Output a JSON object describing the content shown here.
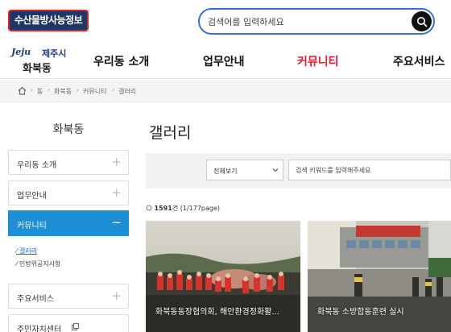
{
  "header": {
    "badge": "수산물방사능정보",
    "search_placeholder": "검색어를 입력하세요"
  },
  "logo": {
    "jeju": "Jeju",
    "city": "제주시",
    "dong": "화북동"
  },
  "nav": {
    "items": [
      {
        "label": "우리동 소개"
      },
      {
        "label": "업무안내"
      },
      {
        "label": "커뮤니티"
      },
      {
        "label": "주요서비스"
      }
    ],
    "active_index": 2
  },
  "breadcrumb": [
    "동",
    "화북동",
    "커뮤니티",
    "갤러리"
  ],
  "sidebar": {
    "title": "화북동",
    "items": [
      {
        "label": "우리동 소개",
        "sign": "+"
      },
      {
        "label": "업무안내",
        "sign": "+"
      },
      {
        "label": "커뮤니티",
        "sign": "−"
      },
      {
        "label": "주요서비스",
        "sign": "+"
      },
      {
        "label": "주민자치센터"
      }
    ],
    "sub_items": [
      {
        "label": "갤러리"
      },
      {
        "label": "민방위공지사항"
      }
    ]
  },
  "main": {
    "title": "갤러리",
    "filter": {
      "select_value": "전체보기",
      "input_placeholder": "검색 키워드를 입력해주세요"
    },
    "count": {
      "total": "1591",
      "unit": "건",
      "page_info": "(1/177page)"
    },
    "gallery": [
      {
        "caption": "화북동동장협의회, 해안환경정화활..."
      },
      {
        "caption": "화북동 소방합동훈련 실시"
      }
    ]
  },
  "colors": {
    "accent_blue": "#1c8fd5",
    "nav_active": "#e8192c",
    "badge_bg": "#1f3764",
    "search_border": "#3a6fd8"
  }
}
